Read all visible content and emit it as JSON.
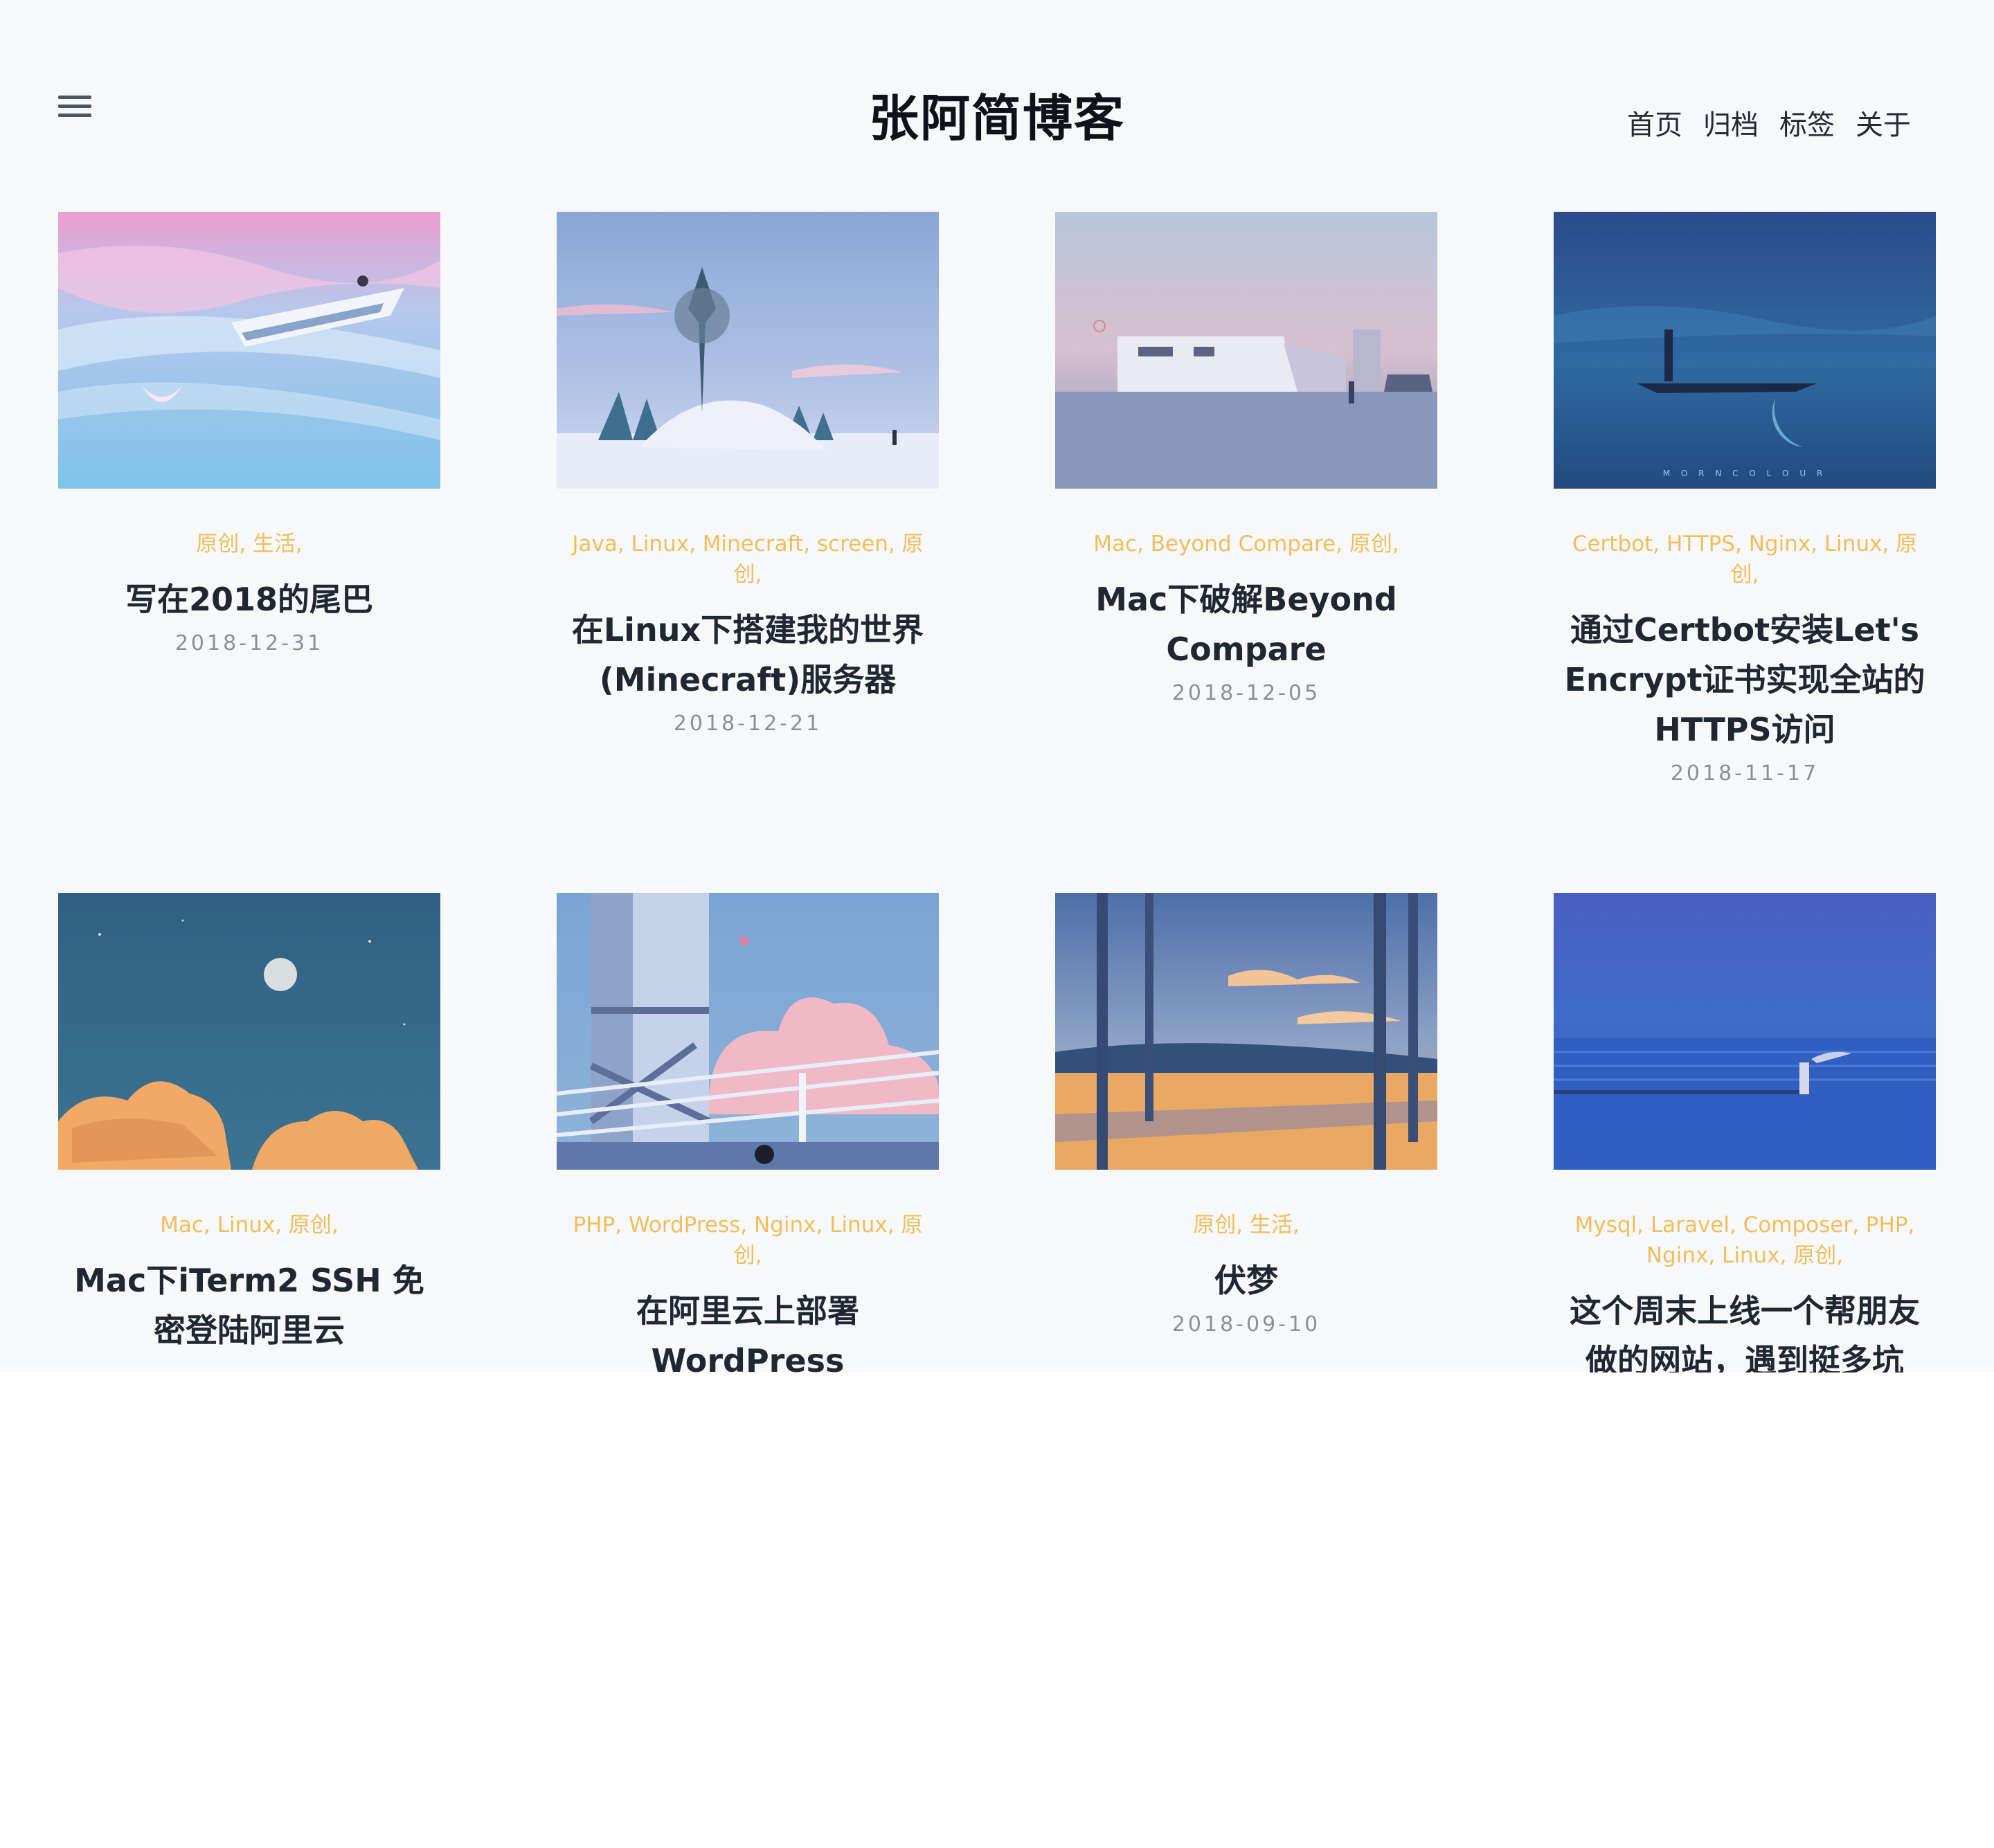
{
  "header": {
    "menu_icon": "hamburger-menu-icon",
    "title": "张阿简博客",
    "nav": [
      "首页",
      "归档",
      "标签",
      "关于"
    ]
  },
  "posts": [
    {
      "tags": [
        "原创",
        "生活"
      ],
      "title": "写在2018的尾巴",
      "date": "2018-12-31",
      "image": "pink-sea-boat-illustration"
    },
    {
      "tags": [
        "Java",
        "Linux",
        "Minecraft",
        "screen",
        "原创"
      ],
      "title": "在Linux下搭建我的世界(Minecraft)服务器",
      "date": "2018-12-21",
      "image": "snowy-island-tree-illustration"
    },
    {
      "tags": [
        "Mac",
        "Beyond Compare",
        "原创"
      ],
      "title": "Mac下破解Beyond Compare",
      "date": "2018-12-05",
      "image": "pastel-building-dusk-illustration"
    },
    {
      "tags": [
        "Certbot",
        "HTTPS",
        "Nginx",
        "Linux",
        "原创"
      ],
      "title": "通过Certbot安装Let's Encrypt证书实现全站的HTTPS访问",
      "date": "2018-11-17",
      "image": "crescent-moon-boat-illustration",
      "image_caption": "M O R N C O L O U R"
    },
    {
      "tags": [
        "Mac",
        "Linux",
        "原创"
      ],
      "title": "Mac下iTerm2 SSH 免密登陆阿里云",
      "date": "",
      "image": "night-sky-moon-clouds-illustration"
    },
    {
      "tags": [
        "PHP",
        "WordPress",
        "Nginx",
        "Linux",
        "原创"
      ],
      "title": "在阿里云上部署WordPress",
      "date": "",
      "image": "tower-railing-cat-illustration"
    },
    {
      "tags": [
        "原创",
        "生活"
      ],
      "title": "伏梦",
      "date": "2018-09-10",
      "image": "forest-sunset-road-illustration"
    },
    {
      "tags": [
        "Mysql",
        "Laravel",
        "Composer",
        "PHP",
        "Nginx",
        "Linux",
        "原创"
      ],
      "title": "这个周末上线一个帮朋友做的网站，遇到挺多坑",
      "date": "",
      "image": "blue-sea-pier-illustration"
    }
  ],
  "colors": {
    "background": "#f7f8fa",
    "tag": "#f2bd5b",
    "title": "#1f2732",
    "date": "#8a9099"
  }
}
